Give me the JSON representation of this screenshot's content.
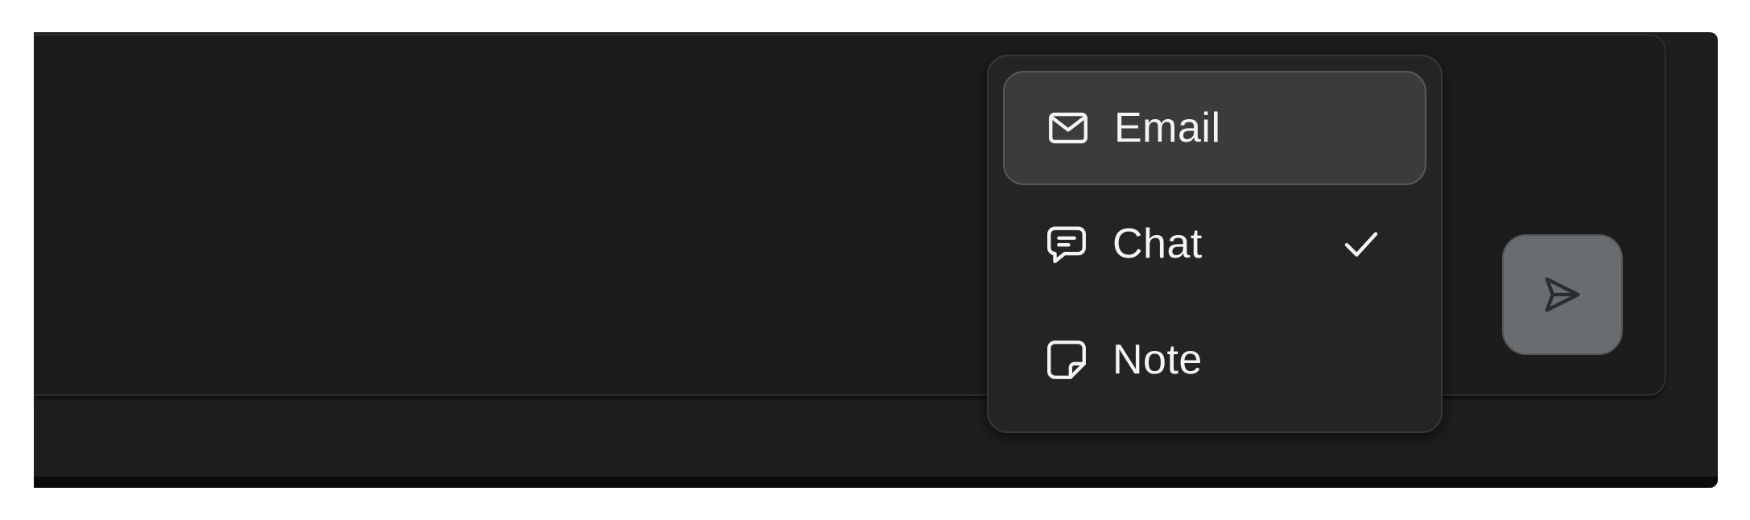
{
  "composer": {
    "send_icon": "send-icon"
  },
  "channel_menu": {
    "items": [
      {
        "label": "Email",
        "icon": "mail-icon",
        "highlighted": true,
        "selected": false
      },
      {
        "label": "Chat",
        "icon": "chat-bubble-icon",
        "highlighted": false,
        "selected": true
      },
      {
        "label": "Note",
        "icon": "sticky-note-icon",
        "highlighted": false,
        "selected": false
      }
    ],
    "selected_indicator_icon": "checkmark-icon"
  },
  "colors": {
    "background": "#1e1e1e",
    "menu_background": "#242424",
    "highlight": "#3b3b3b",
    "send_button": "#6a6d70",
    "text": "#f4f4f4"
  }
}
